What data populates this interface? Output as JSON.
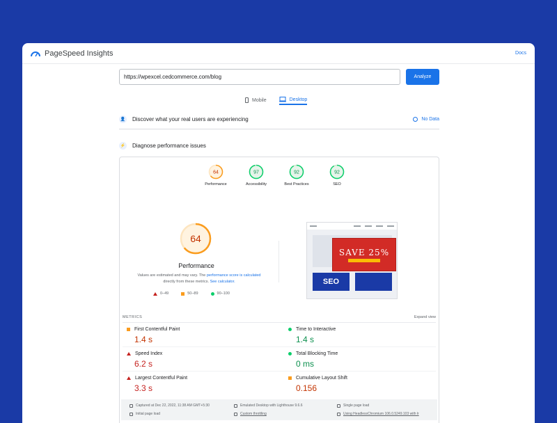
{
  "app": {
    "brand": "PageSpeed Insights",
    "docs_label": "Docs"
  },
  "search": {
    "url": "https://wpexcel.cedcommerce.com/blog",
    "analyze_label": "Analyze"
  },
  "device_tabs": [
    {
      "label": "Mobile",
      "active": false
    },
    {
      "label": "Desktop",
      "active": true
    }
  ],
  "sections": {
    "real_users": "Discover what your real users are experiencing",
    "no_data": "No Data",
    "diagnose": "Diagnose performance issues"
  },
  "categories": [
    {
      "label": "Performance",
      "score": "64",
      "status": "average"
    },
    {
      "label": "Accessibility",
      "score": "97",
      "status": "pass"
    },
    {
      "label": "Best Practices",
      "score": "92",
      "status": "pass"
    },
    {
      "label": "SEO",
      "score": "92",
      "status": "pass"
    }
  ],
  "performance": {
    "score": "64",
    "title": "Performance",
    "disclaimer_1": "Values are estimated and may vary. The ",
    "disclaimer_link_1": "performance score is calculated",
    "disclaimer_2": "directly from these metrics. ",
    "disclaimer_link_2": "See calculator."
  },
  "legend": [
    "0–49",
    "50–89",
    "90–100"
  ],
  "screenshot": {
    "banner_text": "SAVE 25%",
    "block_text": "SEO"
  },
  "metrics": {
    "heading": "METRICS",
    "expand_label": "Expand view",
    "items": [
      {
        "name": "First Contentful Paint",
        "value": "1.4 s",
        "status": "average"
      },
      {
        "name": "Time to Interactive",
        "value": "1.4 s",
        "status": "pass"
      },
      {
        "name": "Speed Index",
        "value": "6.2 s",
        "status": "fail"
      },
      {
        "name": "Total Blocking Time",
        "value": "0 ms",
        "status": "pass"
      },
      {
        "name": "Largest Contentful Paint",
        "value": "3.3 s",
        "status": "fail"
      },
      {
        "name": "Cumulative Layout Shift",
        "value": "0.156",
        "status": "average"
      }
    ]
  },
  "footer": {
    "captured": "Captured at Dec 22, 2022, 11:38 AM GMT+5:30",
    "emulated": "Emulated Desktop with Lighthouse 9.6.6",
    "single_load": "Single page load",
    "initial_load": "Initial page load",
    "throttling": "Custom throttling",
    "using": "Using HeadlessChromium 106.0.5249.103 with lr"
  },
  "colors": {
    "fail": "#c5221f",
    "average": "#c33300",
    "pass": "#0d904f",
    "accent": "#1a73e8"
  }
}
